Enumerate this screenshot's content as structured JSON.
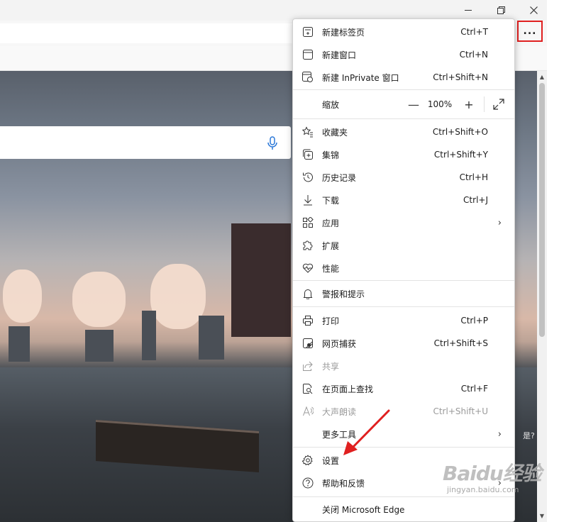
{
  "window": {
    "minimize_icon": "minimize-icon",
    "restore_icon": "restore-icon",
    "close_icon": "close-icon"
  },
  "toolbar": {
    "more_label": "..."
  },
  "page": {
    "partial_text": "是?"
  },
  "menu": {
    "items_top": [
      {
        "id": "new-tab",
        "label": "新建标签页",
        "shortcut": "Ctrl+T",
        "icon": "new-tab-icon"
      },
      {
        "id": "new-window",
        "label": "新建窗口",
        "shortcut": "Ctrl+N",
        "icon": "new-window-icon"
      },
      {
        "id": "new-inprivate",
        "label": "新建 InPrivate 窗口",
        "shortcut": "Ctrl+Shift+N",
        "icon": "inprivate-icon"
      }
    ],
    "zoom": {
      "label": "缩放",
      "minus": "—",
      "value": "100%",
      "plus": "+"
    },
    "items_mid": [
      {
        "id": "favorites",
        "label": "收藏夹",
        "shortcut": "Ctrl+Shift+O"
      },
      {
        "id": "collections",
        "label": "集锦",
        "shortcut": "Ctrl+Shift+Y"
      },
      {
        "id": "history",
        "label": "历史记录",
        "shortcut": "Ctrl+H"
      },
      {
        "id": "downloads",
        "label": "下载",
        "shortcut": "Ctrl+J"
      },
      {
        "id": "apps",
        "label": "应用",
        "shortcut": ""
      },
      {
        "id": "extensions",
        "label": "扩展",
        "shortcut": ""
      },
      {
        "id": "performance",
        "label": "性能",
        "shortcut": ""
      }
    ],
    "alerts": {
      "label": "警报和提示"
    },
    "items_tools": [
      {
        "id": "print",
        "label": "打印",
        "shortcut": "Ctrl+P"
      },
      {
        "id": "web-capture",
        "label": "网页捕获",
        "shortcut": "Ctrl+Shift+S"
      },
      {
        "id": "share",
        "label": "共享",
        "shortcut": ""
      },
      {
        "id": "find",
        "label": "在页面上查找",
        "shortcut": "Ctrl+F"
      },
      {
        "id": "read-aloud",
        "label": "大声朗读",
        "shortcut": "Ctrl+Shift+U"
      },
      {
        "id": "more-tools",
        "label": "更多工具",
        "shortcut": ""
      }
    ],
    "settings": {
      "label": "设置"
    },
    "help": {
      "label": "帮助和反馈"
    },
    "close": {
      "label": "关闭 Microsoft Edge"
    }
  },
  "watermark": {
    "main": "Baidu经验",
    "sub": "jingyan.baidu.com"
  },
  "annotation_color": "#e02020"
}
